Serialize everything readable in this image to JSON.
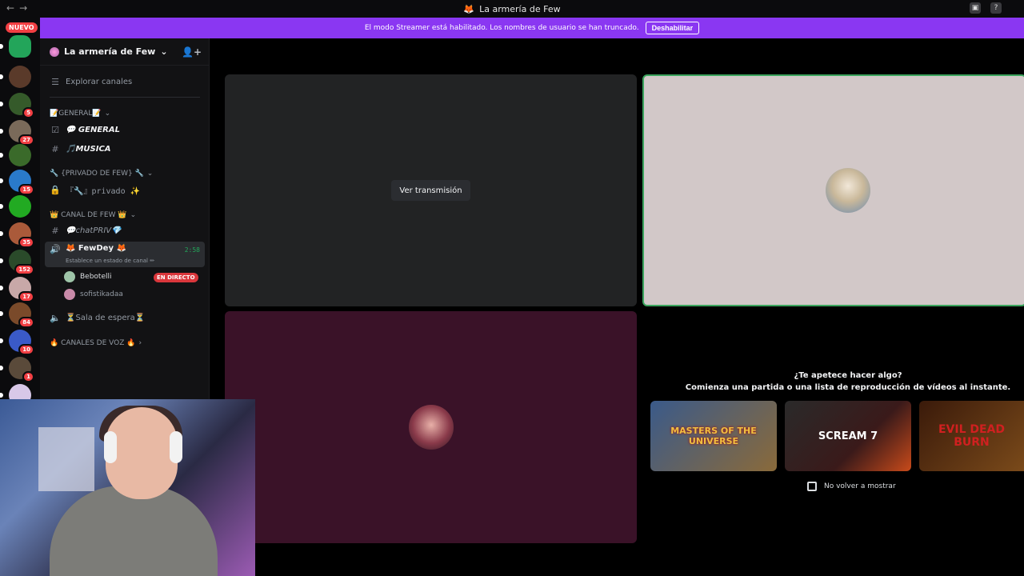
{
  "window": {
    "title": "La armería de Few",
    "nav_back": "←",
    "nav_forward": "→"
  },
  "guilds": {
    "nuevo_label": "NUEVO",
    "items": [
      {
        "color": "#23a55a",
        "badge": ""
      },
      {
        "color": "#5a3a2a",
        "badge": ""
      },
      {
        "color": "#355a2a",
        "badge": "5"
      },
      {
        "color": "#7a6a5a",
        "badge": "27"
      },
      {
        "color": "#3a6a2a",
        "badge": ""
      },
      {
        "color": "#2a7aca",
        "badge": "15"
      },
      {
        "color": "#22aa22",
        "badge": ""
      },
      {
        "color": "#aa5a3a",
        "badge": "35"
      },
      {
        "color": "#2a4a2a",
        "badge": "152"
      },
      {
        "color": "#c8a8a8",
        "badge": "17"
      },
      {
        "color": "#7a4a2a",
        "badge": "84"
      },
      {
        "color": "#3a5ac8",
        "badge": "10"
      },
      {
        "color": "#5a4a3a",
        "badge": "1"
      },
      {
        "color": "#d8c8e8",
        "badge": ""
      }
    ]
  },
  "banner": {
    "text": "El modo Streamer está habilitado. Los nombres de usuario se han truncado.",
    "button": "Deshabilitar"
  },
  "sidebar": {
    "server_name": "La armería de Few",
    "explore": "Explorar canales",
    "categories": [
      {
        "label": "📝GENERAL📝"
      },
      {
        "label": "🔧 {PRIVADO DE FEW} 🔧"
      },
      {
        "label": "👑 CANAL DE FEW 👑"
      },
      {
        "label": "🔥 CANALES DE VOZ 🔥"
      }
    ],
    "channels": {
      "general": "💬 GENERAL",
      "musica": "🎵MUSICA",
      "privado": "『🔧』privado ✨",
      "chatpriv": "💬chatPRIV💎",
      "sala": "⏳Sala de espera⏳"
    },
    "voice": {
      "name": "🦊 FewDey 🦊",
      "status": "Establece un estado de canal ✏",
      "time": "2:58",
      "members": [
        {
          "name": "Bebotelli",
          "avatar_color": "#9ec4a8",
          "live": "EN DIRECTO"
        },
        {
          "name": "sofistikadaa",
          "avatar_color": "#c88aa8"
        }
      ]
    }
  },
  "stage": {
    "watch_button": "Ver transmisión",
    "activity_line1": "¿Te apetece hacer algo?",
    "activity_line2": "Comienza una partida o una lista de reproducción de vídeos al instante.",
    "cards": [
      {
        "title": "MASTERS OF THE UNIVERSE",
        "bg": "#3a5a8a"
      },
      {
        "title": "SCREAM 7",
        "bg": "#1a1a1a"
      },
      {
        "title": "EVIL DEAD BURN",
        "bg": "#4a1a0a"
      }
    ],
    "dont_show": "No volver a mostrar"
  }
}
